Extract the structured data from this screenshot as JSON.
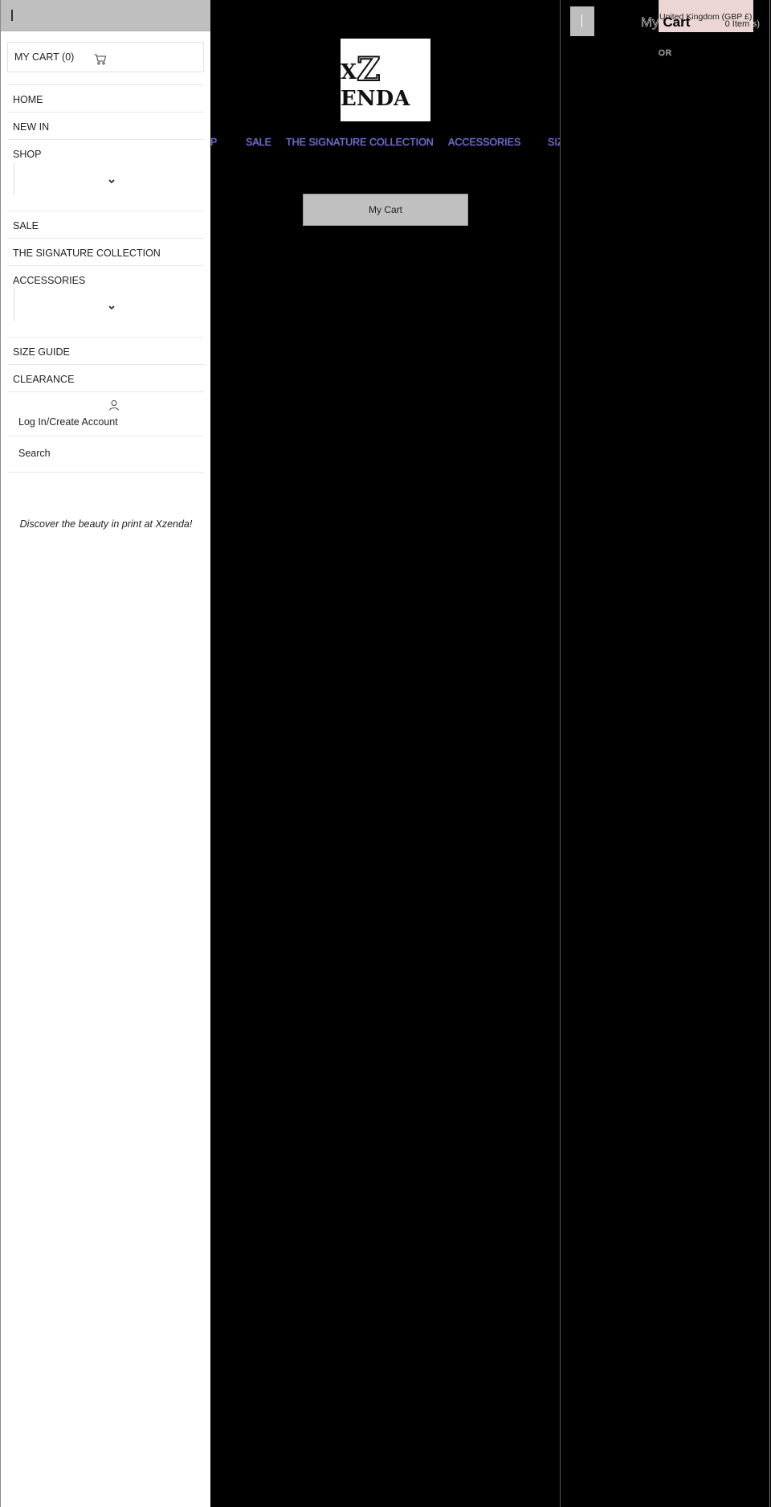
{
  "header": {
    "logo_text_left": "X",
    "logo_text_z": "Z",
    "logo_text_right": "ENDA",
    "logo_alt": "Xzenda"
  },
  "main_nav": {
    "items": [
      {
        "label": "P"
      },
      {
        "label": "SALE"
      },
      {
        "label": "THE SIGNATURE COLLECTION"
      },
      {
        "label": "ACCESSORIES"
      },
      {
        "label": "SIZE GUIDE"
      },
      {
        "label": "CLEARANCE"
      }
    ],
    "link_color": "#6b6bd6"
  },
  "main": {
    "my_cart_button": "My Cart"
  },
  "cart_panel": {
    "locale": "United Kingdom (GBP £)",
    "title_ghost": "My",
    "title": "Cart",
    "item_count": "0 Item",
    "item_count_suffix": "(s)",
    "or_text": "OR",
    "locale_bg": "#ecd5d5"
  },
  "drawer": {
    "cart_label": "MY CART (0)",
    "menu": [
      {
        "label": "HOME",
        "has_sub": false
      },
      {
        "label": "NEW IN",
        "has_sub": false
      },
      {
        "label": "SHOP",
        "has_sub": true
      },
      {
        "label": "SALE",
        "has_sub": false
      },
      {
        "label": "THE SIGNATURE COLLECTION",
        "has_sub": false
      },
      {
        "label": "ACCESSORIES",
        "has_sub": true
      },
      {
        "label": "SIZE GUIDE",
        "has_sub": false
      },
      {
        "label": "CLEARANCE",
        "has_sub": false
      }
    ],
    "account_label": "Log In/Create Account",
    "search_label": "Search",
    "tagline": "Discover the beauty in print at Xzenda!"
  },
  "icons": {
    "cart": "cart-icon",
    "user": "user-icon",
    "chevron": "chevron-down-icon",
    "close": "close-icon"
  }
}
